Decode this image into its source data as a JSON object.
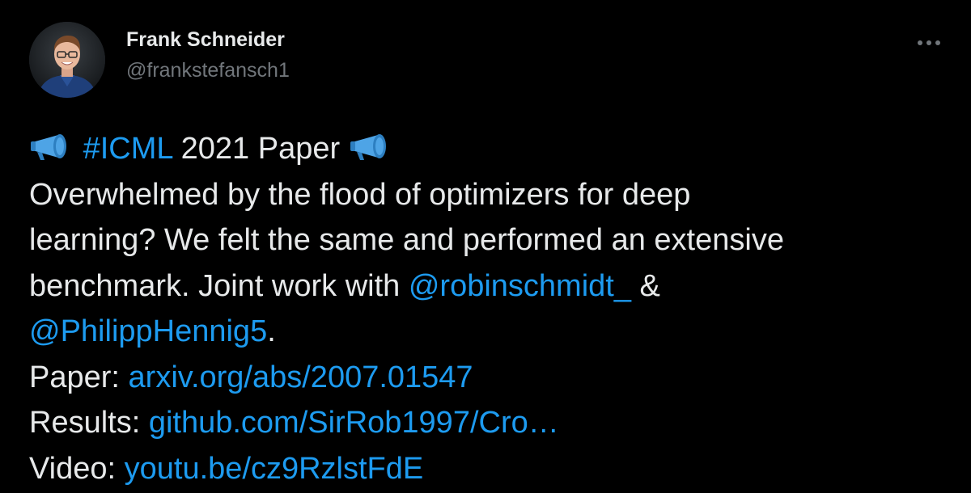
{
  "author": {
    "display_name": "Frank Schneider",
    "handle": "@frankstefansch1"
  },
  "icons": {
    "more": "more-horizontal-icon",
    "megaphone": "megaphone-emoji",
    "avatar": "user-avatar-photo"
  },
  "colors": {
    "background": "#000000",
    "text": "#e7e9ea",
    "secondary": "#71767b",
    "link": "#1d9bf0",
    "emoji_blue": "#4ea4e6"
  },
  "tweet": {
    "headline": {
      "hashtag": "#ICML",
      "rest": " 2021 Paper "
    },
    "body": {
      "line1": "Overwhelmed by the flood of optimizers for deep",
      "line2": "learning? We felt the same and performed an extensive",
      "line3_text": "benchmark. Joint work with ",
      "mention1": "@robinschmidt_",
      "line3_after": " &",
      "mention2": "@PhilippHennig5",
      "line4_after": "."
    },
    "links": {
      "paper_label": "Paper: ",
      "paper_url": "arxiv.org/abs/2007.01547",
      "results_label": "Results: ",
      "results_url": "github.com/SirRob1997/Cro…",
      "video_label": "Video: ",
      "video_url": "youtu.be/cz9RzlstFdE"
    }
  }
}
